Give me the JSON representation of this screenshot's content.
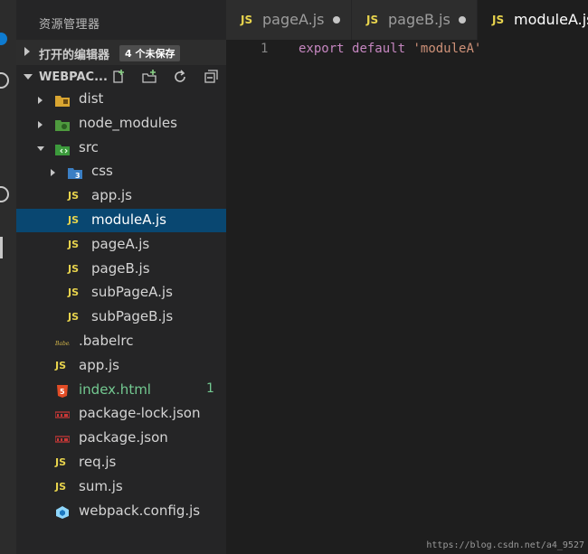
{
  "sidebar": {
    "title": "资源管理器",
    "open_editors": {
      "label": "打开的编辑器",
      "badge": "4 个未保存"
    },
    "project": {
      "label": "WEBPAC..."
    },
    "tree": [
      {
        "label": "dist",
        "icon": "folder-dist-icon",
        "kind": "folder",
        "expanded": false,
        "depth": 0
      },
      {
        "label": "node_modules",
        "icon": "folder-node-icon",
        "kind": "folder",
        "expanded": false,
        "depth": 0
      },
      {
        "label": "src",
        "icon": "folder-src-icon",
        "kind": "folder",
        "expanded": true,
        "depth": 0
      },
      {
        "label": "css",
        "icon": "folder-css-icon",
        "kind": "folder",
        "expanded": false,
        "depth": 1
      },
      {
        "label": "app.js",
        "icon": "js-icon",
        "kind": "file",
        "depth": 1
      },
      {
        "label": "moduleA.js",
        "icon": "js-icon",
        "kind": "file",
        "depth": 1,
        "selected": true
      },
      {
        "label": "pageA.js",
        "icon": "js-icon",
        "kind": "file",
        "depth": 1
      },
      {
        "label": "pageB.js",
        "icon": "js-icon",
        "kind": "file",
        "depth": 1
      },
      {
        "label": "subPageA.js",
        "icon": "js-icon",
        "kind": "file",
        "depth": 1
      },
      {
        "label": "subPageB.js",
        "icon": "js-icon",
        "kind": "file",
        "depth": 1
      },
      {
        "label": ".babelrc",
        "icon": "babel-icon",
        "kind": "file",
        "depth": 0
      },
      {
        "label": "app.js",
        "icon": "js-icon",
        "kind": "file",
        "depth": 0
      },
      {
        "label": "index.html",
        "icon": "html5-icon",
        "kind": "file",
        "depth": 0,
        "badge": "1"
      },
      {
        "label": "package-lock.json",
        "icon": "npm-icon",
        "kind": "file",
        "depth": 0
      },
      {
        "label": "package.json",
        "icon": "npm-icon",
        "kind": "file",
        "depth": 0
      },
      {
        "label": "req.js",
        "icon": "js-icon",
        "kind": "file",
        "depth": 0
      },
      {
        "label": "sum.js",
        "icon": "js-icon",
        "kind": "file",
        "depth": 0
      },
      {
        "label": "webpack.config.js",
        "icon": "webpack-icon",
        "kind": "file",
        "depth": 0
      }
    ]
  },
  "tabs": [
    {
      "icon_text": "JS",
      "label": "pageA.js",
      "unsaved": true
    },
    {
      "icon_text": "JS",
      "label": "pageB.js",
      "unsaved": true
    },
    {
      "icon_text": "JS",
      "label": "moduleA.js",
      "active": true
    }
  ],
  "editor": {
    "line_number": "1",
    "code_keyword1": "export",
    "code_keyword2": "default",
    "code_string": "'moduleA'"
  },
  "js_icon_text": "JS",
  "watermark": "https://blog.csdn.net/a4_9527",
  "colors": {
    "selection": "#094771",
    "js_yellow": "#e8d44d",
    "git_green": "#73c991"
  }
}
